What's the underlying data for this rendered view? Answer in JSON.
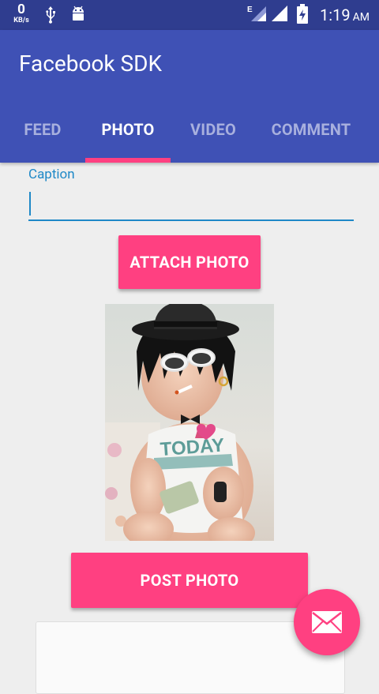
{
  "status_bar": {
    "net_speed_value": "0",
    "net_speed_unit": "KB/s",
    "network_type": "E",
    "time": "1:19",
    "ampm": "AM",
    "icons": [
      "usb-icon",
      "android-icon",
      "signal-icon",
      "signal-full-icon",
      "battery-charging-icon"
    ]
  },
  "app_bar": {
    "title": "Facebook SDK"
  },
  "tabs": [
    {
      "label": "FEED",
      "active": false
    },
    {
      "label": "PHOTO",
      "active": true
    },
    {
      "label": "VIDEO",
      "active": false
    },
    {
      "label": "COMMENT",
      "active": false
    }
  ],
  "form": {
    "caption_label": "Caption",
    "caption_value": "",
    "attach_button": "ATTACH PHOTO",
    "post_button": "POST PHOTO"
  },
  "photo": {
    "icon": "baby-with-hat-and-sunglasses-photo"
  },
  "fab": {
    "icon": "mail-icon"
  },
  "colors": {
    "status_bar": "#2f3d8f",
    "primary": "#3f51b5",
    "accent": "#ff4081",
    "input_accent": "#1e88c7",
    "background": "#eeeeee"
  }
}
